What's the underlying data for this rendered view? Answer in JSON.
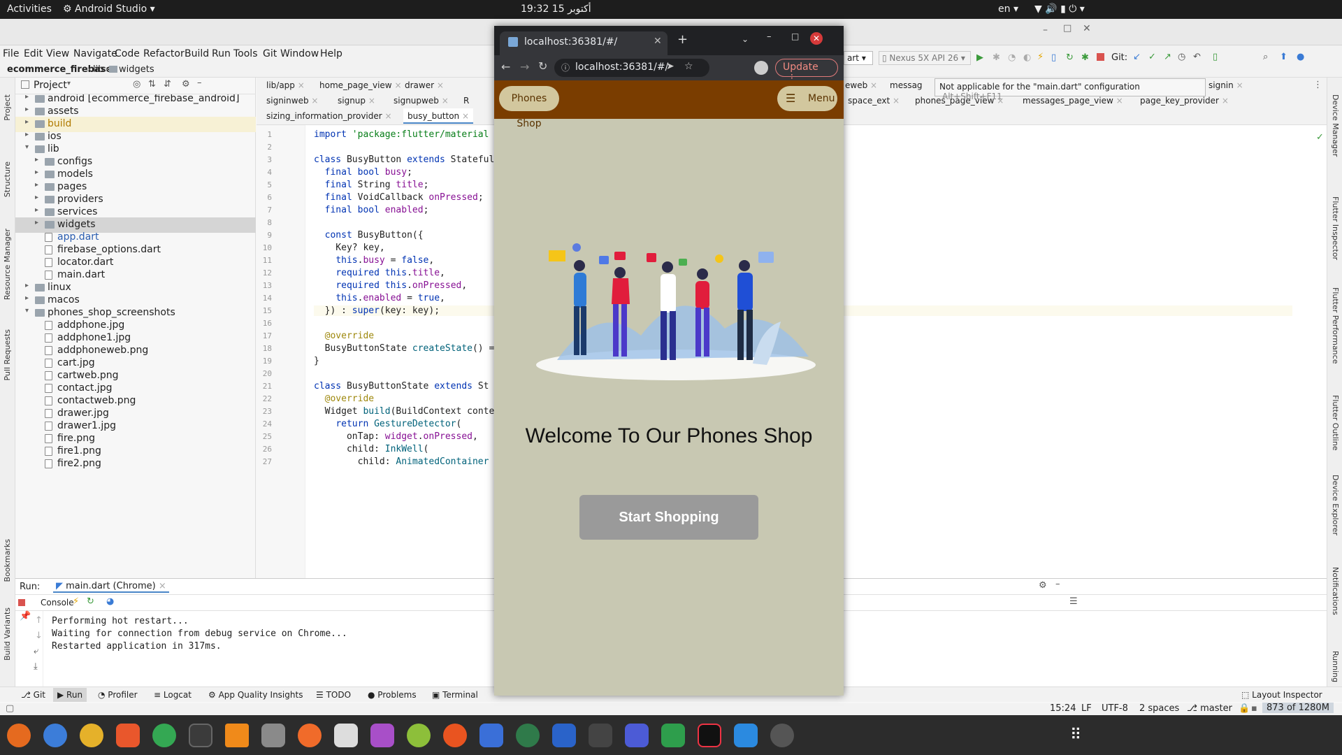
{
  "topbar": {
    "activities": "Activities",
    "app": "Android Studio",
    "clock": "19:32  15 أكتوبر",
    "lang": "en"
  },
  "menu": [
    "File",
    "Edit",
    "View",
    "Navigate",
    "Code",
    "Refactor",
    "Build",
    "Run",
    "Tools",
    "Git",
    "Window",
    "Help"
  ],
  "breadcrumb": [
    "ecommerce_firebase",
    "lib",
    "widgets"
  ],
  "project_panel": {
    "title": "Project",
    "items": [
      {
        "label": "android [ecommerce_firebase_android]",
        "depth": 1,
        "kind": "folder",
        "arrow": "right"
      },
      {
        "label": "assets",
        "depth": 1,
        "kind": "folder",
        "arrow": "right"
      },
      {
        "label": "build",
        "depth": 1,
        "kind": "folder",
        "arrow": "right",
        "highlight": "build"
      },
      {
        "label": "ios",
        "depth": 1,
        "kind": "folder",
        "arrow": "right"
      },
      {
        "label": "lib",
        "depth": 1,
        "kind": "folder",
        "arrow": "down"
      },
      {
        "label": "configs",
        "depth": 2,
        "kind": "folder",
        "arrow": "right"
      },
      {
        "label": "models",
        "depth": 2,
        "kind": "folder",
        "arrow": "right"
      },
      {
        "label": "pages",
        "depth": 2,
        "kind": "folder",
        "arrow": "right"
      },
      {
        "label": "providers",
        "depth": 2,
        "kind": "folder",
        "arrow": "right"
      },
      {
        "label": "services",
        "depth": 2,
        "kind": "folder",
        "arrow": "right"
      },
      {
        "label": "widgets",
        "depth": 2,
        "kind": "folder",
        "arrow": "right",
        "selected": true
      },
      {
        "label": "app.dart",
        "depth": 2,
        "kind": "file",
        "accent": true
      },
      {
        "label": "firebase_options.dart",
        "depth": 2,
        "kind": "file"
      },
      {
        "label": "locator.dart",
        "depth": 2,
        "kind": "file"
      },
      {
        "label": "main.dart",
        "depth": 2,
        "kind": "file"
      },
      {
        "label": "linux",
        "depth": 1,
        "kind": "folder",
        "arrow": "right"
      },
      {
        "label": "macos",
        "depth": 1,
        "kind": "folder",
        "arrow": "right"
      },
      {
        "label": "phones_shop_screenshots",
        "depth": 1,
        "kind": "folder",
        "arrow": "down"
      },
      {
        "label": "addphone.jpg",
        "depth": 2,
        "kind": "file"
      },
      {
        "label": "addphone1.jpg",
        "depth": 2,
        "kind": "file"
      },
      {
        "label": "addphoneweb.png",
        "depth": 2,
        "kind": "file"
      },
      {
        "label": "cart.jpg",
        "depth": 2,
        "kind": "file"
      },
      {
        "label": "cartweb.png",
        "depth": 2,
        "kind": "file"
      },
      {
        "label": "contact.jpg",
        "depth": 2,
        "kind": "file"
      },
      {
        "label": "contactweb.png",
        "depth": 2,
        "kind": "file"
      },
      {
        "label": "drawer.jpg",
        "depth": 2,
        "kind": "file"
      },
      {
        "label": "drawer1.jpg",
        "depth": 2,
        "kind": "file"
      },
      {
        "label": "fire.png",
        "depth": 2,
        "kind": "file"
      },
      {
        "label": "fire1.png",
        "depth": 2,
        "kind": "file"
      },
      {
        "label": "fire2.png",
        "depth": 2,
        "kind": "file"
      }
    ]
  },
  "editor_tabs_row1": [
    "lib/app",
    "home_page_view",
    "drawer",
    "eweb",
    "messag",
    "signin"
  ],
  "editor_tabs_row2": [
    "signinweb",
    "signup",
    "signupweb",
    "R",
    "space_ext",
    "phones_page_view",
    "messages_page_view",
    "page_key_provider"
  ],
  "editor_tabs_row3": [
    "sizing_information_provider",
    "busy_button"
  ],
  "run_config": {
    "device": "Nexus 5X API 26",
    "git": "Git:",
    "config_partial": "art"
  },
  "tooltip": {
    "text": "Not applicable for the \"main.dart\" configuration",
    "shortcut": "Alt+Shift+F11"
  },
  "code_lines": [
    {
      "n": "1",
      "html": "<span class='kw'>import</span> <span class='str'>'package:flutter/material</span>"
    },
    {
      "n": "2",
      "html": ""
    },
    {
      "n": "3",
      "html": "<span class='kw'>class</span> BusyButton <span class='kw'>extends</span> Stateful"
    },
    {
      "n": "4",
      "html": "  <span class='kw'>final</span> <span class='kw'>bool</span> <span class='fld'>busy</span>;"
    },
    {
      "n": "5",
      "html": "  <span class='kw'>final</span> String <span class='fld'>title</span>;"
    },
    {
      "n": "6",
      "html": "  <span class='kw'>final</span> VoidCallback <span class='fld'>onPressed</span>;"
    },
    {
      "n": "7",
      "html": "  <span class='kw'>final</span> <span class='kw'>bool</span> <span class='fld'>enabled</span>;"
    },
    {
      "n": "8",
      "html": ""
    },
    {
      "n": "9",
      "html": "  <span class='kw'>const</span> BusyButton({"
    },
    {
      "n": "10",
      "html": "    Key? key,"
    },
    {
      "n": "11",
      "html": "    <span class='kw'>this</span>.<span class='fld'>busy</span> = <span class='kw'>false</span>,"
    },
    {
      "n": "12",
      "html": "    <span class='kw'>required</span> <span class='kw'>this</span>.<span class='fld'>title</span>,"
    },
    {
      "n": "13",
      "html": "    <span class='kw'>required</span> <span class='kw'>this</span>.<span class='fld'>onPressed</span>,"
    },
    {
      "n": "14",
      "html": "    <span class='kw'>this</span>.<span class='fld'>enabled</span> = <span class='kw'>true</span>,"
    },
    {
      "n": "15",
      "html": "  }) : <span class='kw'>super</span>(key: key);"
    },
    {
      "n": "16",
      "html": ""
    },
    {
      "n": "17",
      "html": "  <span class='ann'>@override</span>"
    },
    {
      "n": "18",
      "html": "  BusyButtonState <span class='cls'>createState</span>() ="
    },
    {
      "n": "19",
      "html": "}"
    },
    {
      "n": "20",
      "html": ""
    },
    {
      "n": "21",
      "html": "<span class='kw'>class</span> BusyButtonState <span class='kw'>extends</span> St"
    },
    {
      "n": "22",
      "html": "  <span class='ann'>@override</span>"
    },
    {
      "n": "23",
      "html": "  Widget <span class='cls'>build</span>(BuildContext conte"
    },
    {
      "n": "24",
      "html": "    <span class='kw'>return</span> <span class='cls'>GestureDetector</span>("
    },
    {
      "n": "25",
      "html": "      onTap: <span class='fld'>widget</span>.<span class='fld'>onPressed</span>,"
    },
    {
      "n": "26",
      "html": "      child: <span class='cls'>InkWell</span>("
    },
    {
      "n": "27",
      "html": "        child: <span class='cls'>AnimatedContainer</span>"
    }
  ],
  "run_panel": {
    "label": "Run:",
    "config": "main.dart (Chrome)",
    "console_tab": "Console",
    "lines": [
      "Performing hot restart...",
      "Waiting for connection from debug service on Chrome...",
      "Restarted application in 317ms."
    ]
  },
  "tool_windows": [
    "Git",
    "Run",
    "Profiler",
    "Logcat",
    "App Quality Insights",
    "TODO",
    "Problems",
    "Terminal",
    "Layout Inspector"
  ],
  "left_strip": [
    "Project",
    "Structure",
    "Resource Manager",
    "Pull Requests",
    "Bookmarks",
    "Build Variants"
  ],
  "right_strip": [
    "Device Manager",
    "Flutter Inspector",
    "Flutter Performance",
    "Flutter Outline",
    "Device Explorer",
    "Notifications",
    "Running"
  ],
  "status": {
    "pos": "15:24",
    "eol": "LF",
    "enc": "UTF-8",
    "indent": "2 spaces",
    "branch": "master",
    "memory": "873 of 1280M"
  },
  "chrome": {
    "tab_title": "localhost:36381/#/",
    "url": "localhost:36381/#/",
    "update": "Update"
  },
  "shop": {
    "brand": "Phones Shop",
    "menu": "Menu",
    "welcome": "Welcome To Our Phones Shop",
    "cta": "Start Shopping"
  },
  "colors": {
    "appbar": "#7a3d00",
    "appbg": "#c8c8b2",
    "button": "#9a9a9a",
    "pill": "#d2c79e"
  }
}
